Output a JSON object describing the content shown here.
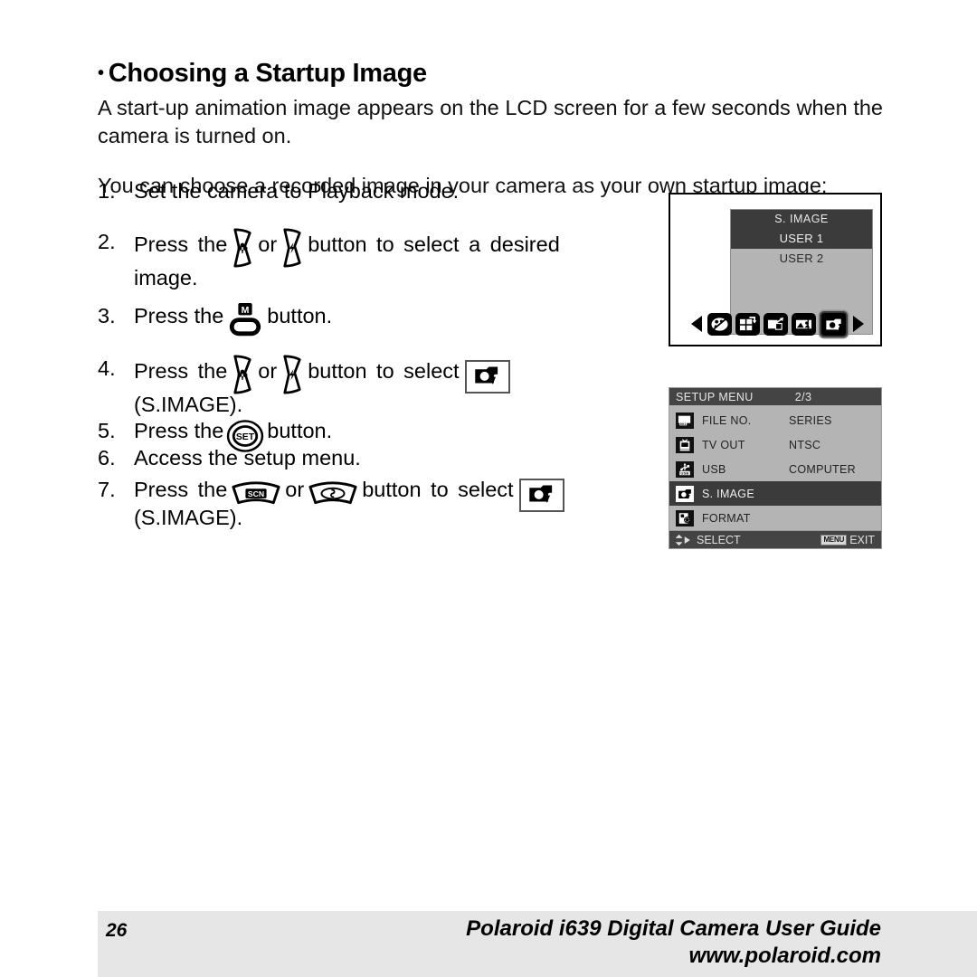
{
  "heading": {
    "bullet": "•",
    "text": "Choosing a Startup Image"
  },
  "intro_paragraph": "A start-up animation image appears on the LCD screen for a few seconds when the camera is turned on.",
  "choose_line": "You can choose a recorded image in your camera as your own startup image:",
  "steps": [
    {
      "num": "1.",
      "text": "Set the camera to Playback mode."
    },
    {
      "num": "2.",
      "pre": "Press the",
      "mid": "or",
      "post": "button to select a desired",
      "second_line": "image."
    },
    {
      "num": "3.",
      "pre": "Press the",
      "post": "button."
    },
    {
      "num": "4.",
      "pre": "Press  the",
      "mid": "or",
      "post": "button  to  select",
      "second_line": "(S.IMAGE)."
    },
    {
      "num": "5.",
      "pre": "Press the",
      "post": "button."
    },
    {
      "num": "6.",
      "text": "Access the setup menu."
    },
    {
      "num": "7.",
      "pre": "Press  the",
      "mid": "or",
      "post": "button  to  select",
      "second_line": "(S.IMAGE)."
    }
  ],
  "button_icons": {
    "macro": "macro-flower-button-icon",
    "flash": "flash-lightning-button-icon",
    "menu": "menu-m-button-icon",
    "set": "set-button-icon",
    "scene": "scn-scene-button-icon",
    "self_timer": "self-timer-button-icon",
    "startup_image": "startup-image-icon"
  },
  "lcd_screen": {
    "list_title": "S. IMAGE",
    "options": [
      {
        "label": "USER 1",
        "selected": true
      },
      {
        "label": "USER 2",
        "selected": false
      }
    ],
    "icon_bar": {
      "left_arrow": "left-triangle-icon",
      "right_arrow": "right-triangle-icon",
      "icons": [
        "effect-palette-icon",
        "thumbnail-grid-icon",
        "resize-icon",
        "slideshow-icon",
        "startup-image-icon"
      ]
    }
  },
  "setup_menu": {
    "title": "SETUP MENU",
    "page_indicator": "2/3",
    "rows": [
      {
        "icon": "file-number-icon",
        "label": "FILE NO.",
        "value": "SERIES",
        "selected": false
      },
      {
        "icon": "tv-out-icon",
        "label": "TV OUT",
        "value": "NTSC",
        "selected": false
      },
      {
        "icon": "usb-icon",
        "label": "USB",
        "value": "COMPUTER",
        "selected": false
      },
      {
        "icon": "startup-image-icon",
        "label": "S. IMAGE",
        "value": "",
        "selected": true
      },
      {
        "icon": "format-icon",
        "label": "FORMAT",
        "value": "",
        "selected": false
      }
    ],
    "footer": {
      "select_label": "SELECT",
      "menu_chip": "MENU",
      "exit_label": "EXIT",
      "arrows_icon": "up-down-right-arrows-icon"
    }
  },
  "footer": {
    "page_number": "26",
    "title": "Polaroid i639 Digital Camera User Guide",
    "url": "www.polaroid.com"
  },
  "colors": {
    "page_background": "#ffffff",
    "text": "#000000",
    "footer_band": "#e6e6e6",
    "lcd_list_background": "#b4b4b4",
    "lcd_selected": "#3b3b3b",
    "menu_header": "#444444"
  }
}
